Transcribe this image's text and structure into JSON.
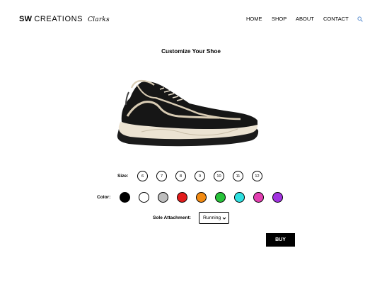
{
  "header": {
    "brand_bold": "SW",
    "brand_rest": "CREATIONS",
    "brand_script": "Clarks",
    "nav": [
      "HOME",
      "SHOP",
      "ABOUT",
      "CONTACT"
    ],
    "search_icon": "search-icon"
  },
  "main": {
    "title": "Customize Your Shoe",
    "size_label": "Size:",
    "sizes": [
      "6",
      "7",
      "8",
      "9",
      "10",
      "11",
      "12"
    ],
    "color_label": "Color:",
    "colors": [
      "#000000",
      "#ffffff",
      "#bdbdbd",
      "#e21b1b",
      "#f28a12",
      "#27c23a",
      "#2fe0e0",
      "#e23fb1",
      "#a233e0"
    ],
    "sole_label": "Sole Attachment:",
    "sole_value": "Running",
    "buy_label": "BUY"
  }
}
